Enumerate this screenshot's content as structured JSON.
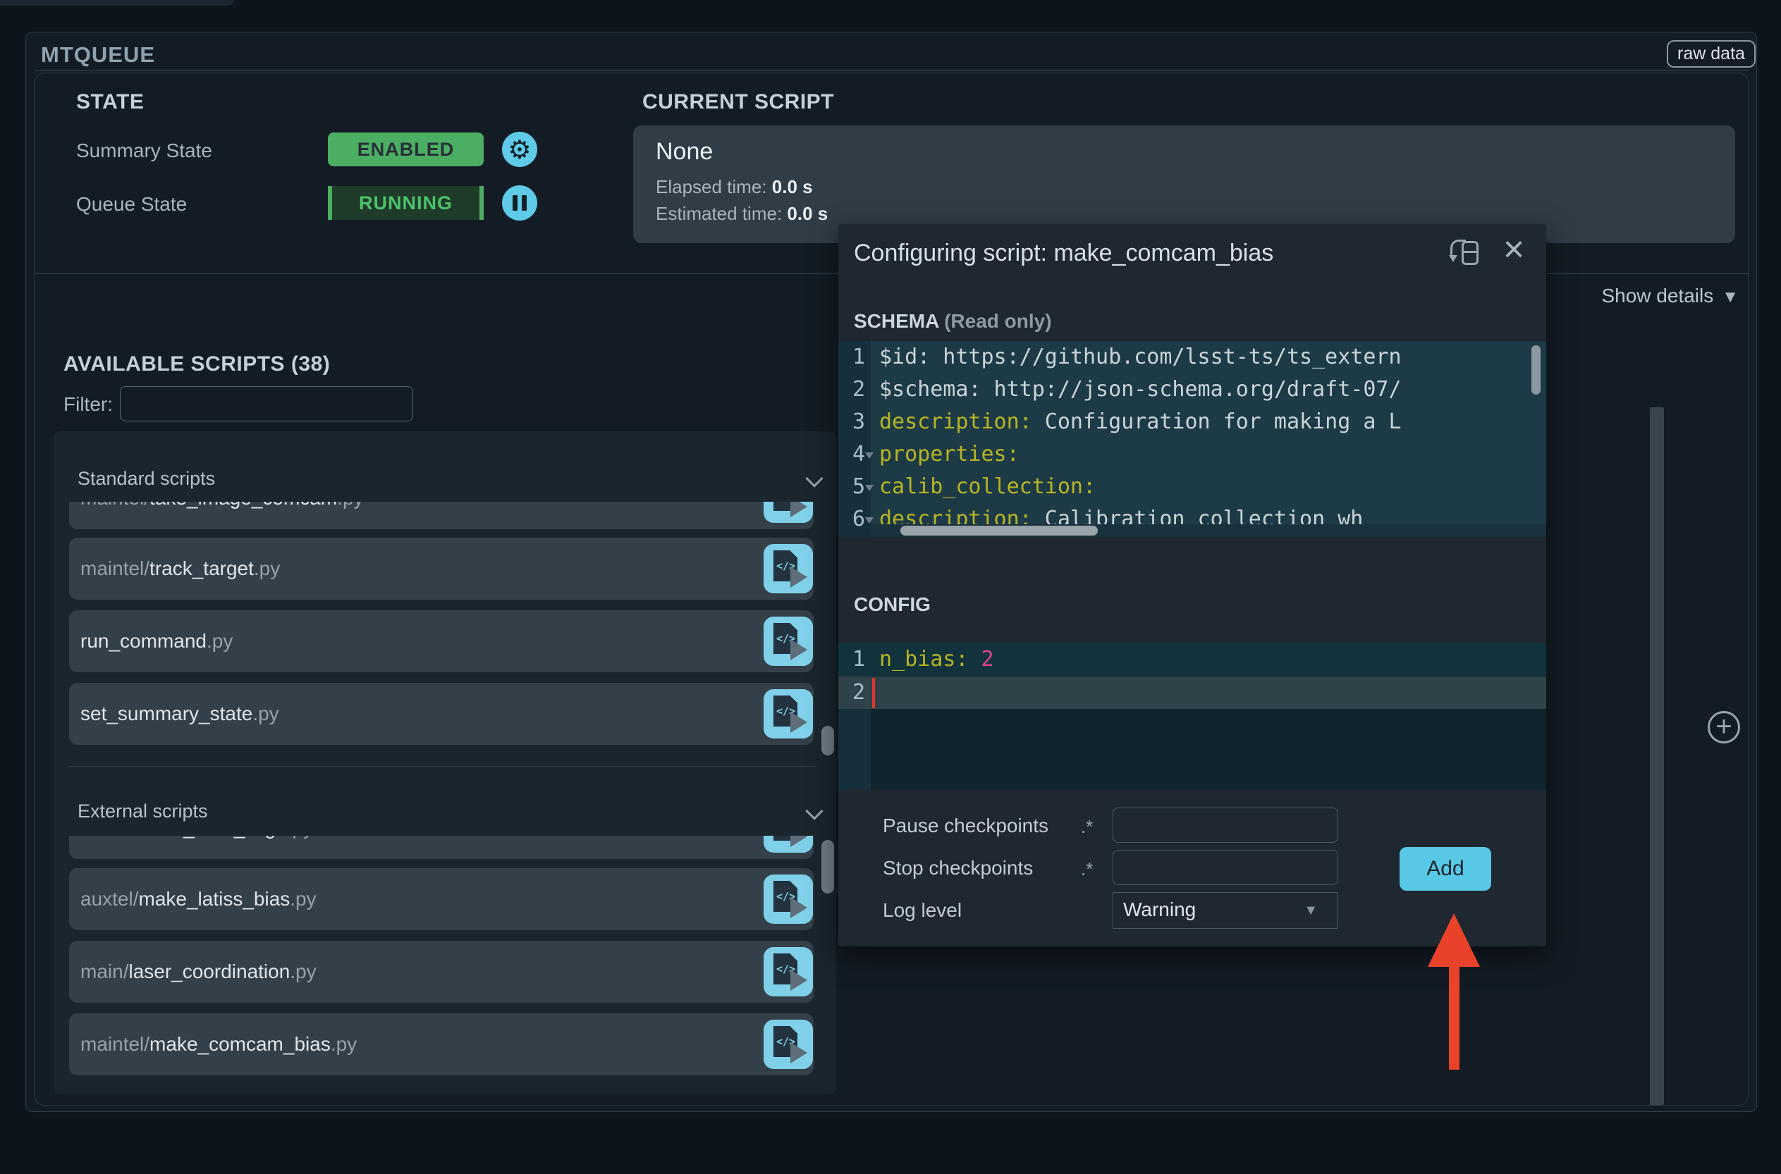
{
  "panel": {
    "title": "MTQUEUE",
    "raw_data_label": "raw data"
  },
  "state": {
    "heading": "STATE",
    "summary_label": "Summary State",
    "summary_value": "ENABLED",
    "queue_label": "Queue State",
    "queue_value": "RUNNING"
  },
  "current_script": {
    "heading": "CURRENT SCRIPT",
    "name": "None",
    "elapsed_label": "Elapsed time:",
    "elapsed_value": "0.0 s",
    "estimated_label": "Estimated time:",
    "estimated_value": "0.0 s",
    "show_details_label": "Show details",
    "show_details_caret": "▼"
  },
  "available": {
    "heading": "AVAILABLE SCRIPTS (38)",
    "filter_label": "Filter:",
    "filter_value": "",
    "sections": [
      {
        "label": "Standard scripts",
        "items": [
          {
            "prefix": "maintel/",
            "name": "take_image_comcam",
            "ext": ".py",
            "clipped": true
          },
          {
            "prefix": "maintel/",
            "name": "track_target",
            "ext": ".py",
            "clipped": false
          },
          {
            "prefix": "",
            "name": "run_command",
            "ext": ".py",
            "clipped": false
          },
          {
            "prefix": "",
            "name": "set_summary_state",
            "ext": ".py",
            "clipped": false
          }
        ]
      },
      {
        "label": "External scripts",
        "items": [
          {
            "prefix": "auxtel/",
            "name": "latiss_cwfs_align",
            "ext": ".py",
            "clipped": true
          },
          {
            "prefix": "auxtel/",
            "name": "make_latiss_bias",
            "ext": ".py",
            "clipped": false
          },
          {
            "prefix": "main/",
            "name": "laser_coordination",
            "ext": ".py",
            "clipped": false
          },
          {
            "prefix": "maintel/",
            "name": "make_comcam_bias",
            "ext": ".py",
            "clipped": false
          }
        ]
      }
    ]
  },
  "dialog": {
    "title": "Configuring script: make_comcam_bias",
    "schema_label": "SCHEMA",
    "schema_readonly": "(Read only)",
    "schema_lines": [
      {
        "num": "1",
        "fold": false,
        "tokens": [
          {
            "t": "plain",
            "v": "$id: https://github.com/lsst-ts/ts_extern"
          }
        ]
      },
      {
        "num": "2",
        "fold": false,
        "tokens": [
          {
            "t": "plain",
            "v": "$schema: http://json-schema.org/draft-07/"
          }
        ]
      },
      {
        "num": "3",
        "fold": false,
        "tokens": [
          {
            "t": "key",
            "v": "description:"
          },
          {
            "t": "plain",
            "v": " Configuration for making a L"
          }
        ]
      },
      {
        "num": "4",
        "fold": true,
        "tokens": [
          {
            "t": "key",
            "v": "properties:"
          }
        ]
      },
      {
        "num": "5",
        "fold": true,
        "tokens": [
          {
            "t": "plain",
            "v": "  "
          },
          {
            "t": "key",
            "v": "calib_collection:"
          }
        ]
      },
      {
        "num": "6",
        "fold": true,
        "tokens": [
          {
            "t": "plain",
            "v": "    "
          },
          {
            "t": "key",
            "v": "description:"
          },
          {
            "t": "plain",
            "v": " Calibration collection wh"
          }
        ]
      }
    ],
    "config_label": "CONFIG",
    "config_lines": [
      {
        "num": "1",
        "active": false,
        "cursor": false,
        "tokens": [
          {
            "t": "key",
            "v": "n_bias:"
          },
          {
            "t": "num",
            "v": " 2"
          }
        ]
      },
      {
        "num": "2",
        "active": true,
        "cursor": true,
        "tokens": []
      }
    ],
    "pause_label": "Pause checkpoints",
    "pause_hint": ".*",
    "pause_value": "",
    "stop_label": "Stop checkpoints",
    "stop_hint": ".*",
    "stop_value": "",
    "log_label": "Log level",
    "log_value": "Warning",
    "add_label": "Add"
  },
  "colors": {
    "accent_cyan": "#57c8e6",
    "state_green": "#4cae62",
    "code_key": "#b8b525",
    "code_number": "#d8468c",
    "arrow_red": "#e8422b",
    "panel_bg": "#131c24",
    "dialog_bg": "#1f2830"
  }
}
